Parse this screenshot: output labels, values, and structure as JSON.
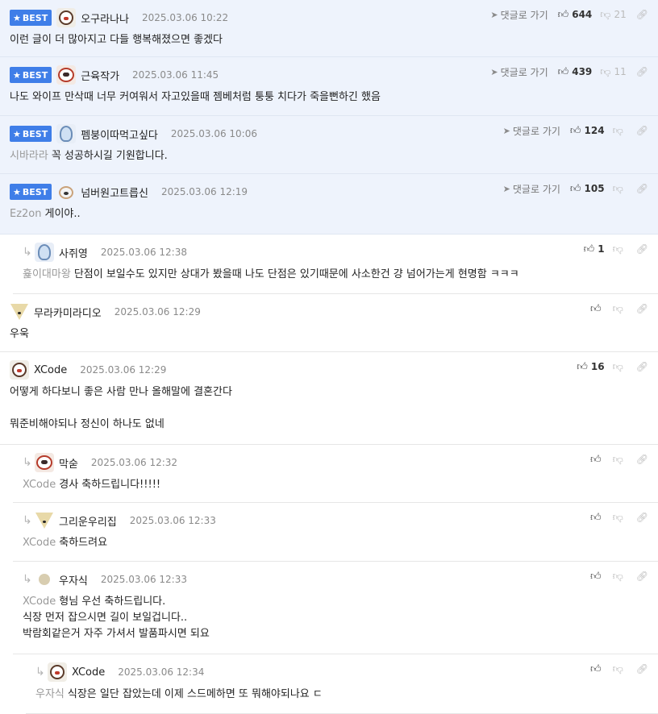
{
  "labels": {
    "best": "BEST",
    "goto_reply": "댓글로 가기"
  },
  "comments": [
    {
      "best": true,
      "nick": "오구라나나",
      "date": "2025.03.06 10:22",
      "up": "644",
      "down": "21",
      "mention": "",
      "lines": [
        "이런 글이 더 많아지고 다들 행복해졌으면 좋겠다"
      ]
    },
    {
      "best": true,
      "nick": "근육작가",
      "date": "2025.03.06 11:45",
      "up": "439",
      "down": "11",
      "mention": "",
      "lines": [
        "나도 와이프 만삭때 너무 커여워서 자고있을때 젬베처럼 퉁퉁 치다가 죽을뻔하긴 했음"
      ]
    },
    {
      "best": true,
      "nick": "펨붕이따먹고싶다",
      "date": "2025.03.06 10:06",
      "up": "124",
      "down": "",
      "mention": "시바라라",
      "lines": [
        "꼭 성공하시길 기원합니다."
      ]
    },
    {
      "best": true,
      "nick": "넘버원고트릅신",
      "date": "2025.03.06 12:19",
      "up": "105",
      "down": "",
      "mention": "Ez2on",
      "lines": [
        "게이야.."
      ]
    },
    {
      "best": false,
      "nick": "사쥐영",
      "date": "2025.03.06 12:38",
      "up": "1",
      "down": "",
      "mention": "흁이대마왕",
      "lines": [
        "단점이 보일수도 있지만 상대가 봤을때 나도 단점은 있기때문에 사소한건 걍 넘어가는게 현명함 ㅋㅋㅋ"
      ]
    },
    {
      "best": false,
      "nick": "무라카미라디오",
      "date": "2025.03.06 12:29",
      "up": "",
      "down": "",
      "mention": "",
      "lines": [
        "우욱"
      ]
    },
    {
      "best": false,
      "nick": "XCode",
      "date": "2025.03.06 12:29",
      "up": "16",
      "down": "",
      "mention": "",
      "lines": [
        "어떻게 하다보니 좋은 사람 만나 올해말에 결혼간다",
        "",
        "뭐준비해야되나 정신이 하나도 없네"
      ]
    },
    {
      "best": false,
      "nick": "막숟",
      "date": "2025.03.06 12:32",
      "up": "",
      "down": "",
      "mention": "XCode",
      "lines": [
        "경사 축하드립니다!!!!!"
      ]
    },
    {
      "best": false,
      "nick": "그리운우리집",
      "date": "2025.03.06 12:33",
      "up": "",
      "down": "",
      "mention": "XCode",
      "lines": [
        "축하드려요"
      ]
    },
    {
      "best": false,
      "nick": "우자식",
      "date": "2025.03.06 12:33",
      "up": "",
      "down": "",
      "mention": "XCode",
      "lines": [
        "형님 우선 축하드립니다.",
        "식장 먼저 잡으시면 길이 보일겁니다..",
        "박람회같은거 자주 가셔서 발품파시면 되요"
      ]
    },
    {
      "best": false,
      "nick": "XCode",
      "date": "2025.03.06 12:34",
      "up": "",
      "down": "",
      "mention": "우자식",
      "lines": [
        "식장은 일단 잡았는데 이제 스드메하면 또 뭐해야되나요 ㄷ"
      ]
    }
  ]
}
